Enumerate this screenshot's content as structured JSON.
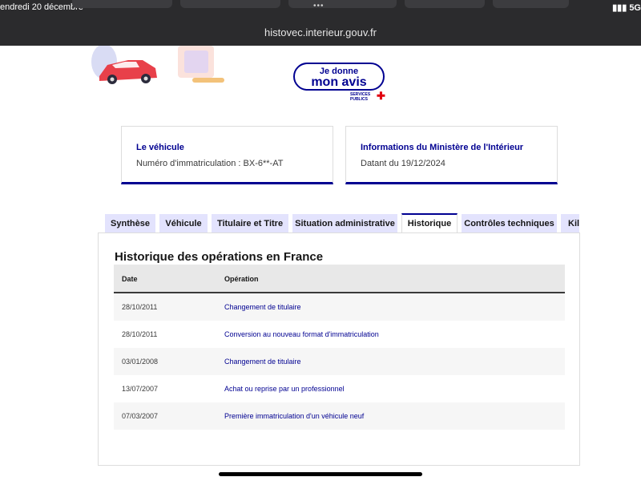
{
  "status_bar": {
    "time": "endredi 20 décembre",
    "network": "5G"
  },
  "browser": {
    "url": "histovec.interieur.gouv.fr"
  },
  "feedback_badge": {
    "line1": "Je donne",
    "line2": "mon avis",
    "logo_line1": "SERVICES",
    "logo_line2": "PUBLICS"
  },
  "cards": [
    {
      "title": "Le véhicule",
      "text": "Numéro d'immatriculation : BX-6**-AT"
    },
    {
      "title": "Informations du Ministère de l'Intérieur",
      "text": "Datant du 19/12/2024"
    }
  ],
  "tabs": [
    {
      "label": "Synthèse",
      "active": false
    },
    {
      "label": "Véhicule",
      "active": false
    },
    {
      "label": "Titulaire et Titre",
      "active": false
    },
    {
      "label": "Situation administrative",
      "active": false
    },
    {
      "label": "Historique",
      "active": true
    },
    {
      "label": "Contrôles techniques",
      "active": false
    },
    {
      "label": "Kil",
      "active": false
    }
  ],
  "history": {
    "title": "Historique des opérations en France",
    "columns": {
      "date": "Date",
      "operation": "Opération"
    },
    "rows": [
      {
        "date": "28/10/2011",
        "operation": "Changement de titulaire"
      },
      {
        "date": "28/10/2011",
        "operation": "Conversion au nouveau format d'immatriculation"
      },
      {
        "date": "03/01/2008",
        "operation": "Changement de titulaire"
      },
      {
        "date": "13/07/2007",
        "operation": "Achat ou reprise par un professionnel"
      },
      {
        "date": "07/03/2007",
        "operation": "Première immatriculation d'un véhicule neuf"
      }
    ]
  },
  "colors": {
    "accent": "#000091",
    "tab_bg": "#e3e3fd",
    "browser_bar": "#2b2b2d"
  }
}
